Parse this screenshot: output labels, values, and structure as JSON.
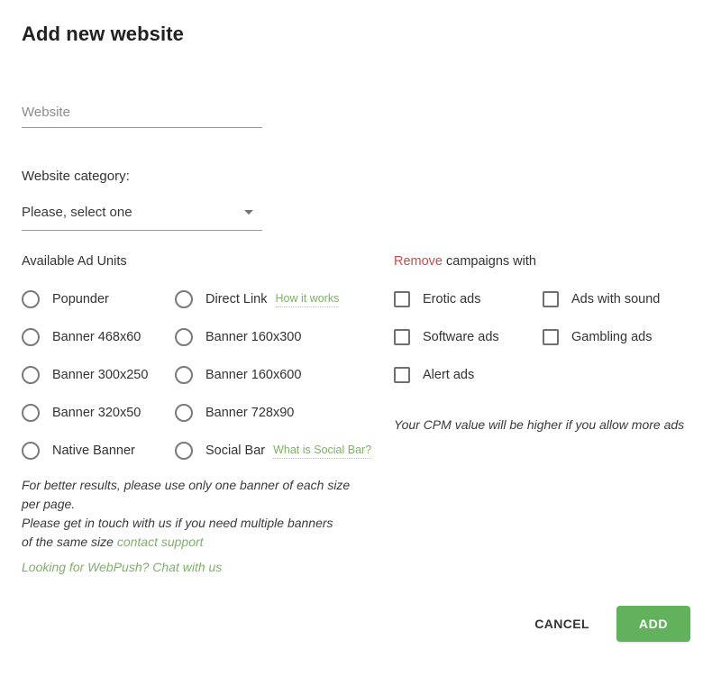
{
  "dialog": {
    "title": "Add new website"
  },
  "website_field": {
    "placeholder": "Website",
    "value": ""
  },
  "category": {
    "label": "Website category:",
    "selected": "Please, select one",
    "caret_icon": "chevron-down-icon"
  },
  "ad_units": {
    "heading": "Available Ad Units",
    "options": [
      {
        "label": "Popunder",
        "hint": null
      },
      {
        "label": "Direct Link",
        "hint": "How it works"
      },
      {
        "label": "Banner 468x60",
        "hint": null
      },
      {
        "label": "Banner 160x300",
        "hint": null
      },
      {
        "label": "Banner 300x250",
        "hint": null
      },
      {
        "label": "Banner 160x600",
        "hint": null
      },
      {
        "label": "Banner 320x50",
        "hint": null
      },
      {
        "label": "Banner 728x90",
        "hint": null
      },
      {
        "label": "Native Banner",
        "hint": null
      },
      {
        "label": "Social Bar",
        "hint": "What is Social Bar?"
      }
    ]
  },
  "remove_campaigns": {
    "heading_accent": "Remove",
    "heading_rest": " campaigns with",
    "options": [
      {
        "label": "Erotic ads"
      },
      {
        "label": "Ads with sound"
      },
      {
        "label": "Software ads"
      },
      {
        "label": "Gambling ads"
      },
      {
        "label": "Alert ads"
      }
    ],
    "cpm_note": "Your CPM value will be higher if you allow more ads"
  },
  "notes": {
    "line1": "For better results, please use only one banner of each size",
    "line2": "per page.",
    "line3": "Please get in touch with us if you need multiple banners",
    "line4_prefix": "of the same size ",
    "line4_link": "contact support",
    "webpush_link": "Looking for WebPush? Chat with us"
  },
  "actions": {
    "cancel_label": "CANCEL",
    "add_label": "ADD"
  },
  "colors": {
    "accent_green": "#62b15c",
    "link_green": "#7fb069",
    "remove_red": "#c0504d",
    "text": "#333333",
    "placeholder": "#8c8c8c"
  }
}
